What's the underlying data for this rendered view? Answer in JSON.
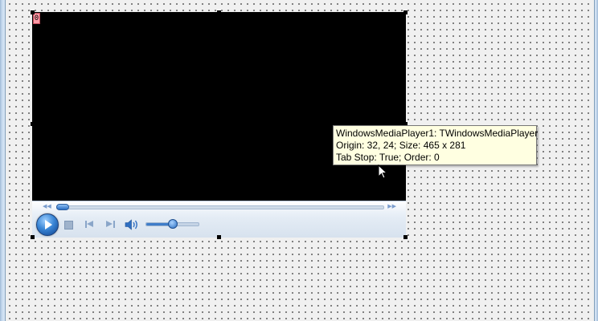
{
  "designer": {
    "grid": "dotted"
  },
  "component": {
    "index_badge": "0",
    "background_color": "#000000",
    "controls": {
      "seek_position": 0.0,
      "volume_level": 0.5,
      "icons": {
        "rewind": "rewind-icon",
        "fast_forward": "fast-forward-icon",
        "play": "play-icon",
        "stop": "stop-icon",
        "previous": "previous-track-icon",
        "next": "next-track-icon",
        "mute": "speaker-icon"
      },
      "accent_color": "#2c6fc4"
    }
  },
  "tooltip": {
    "line1": "WindowsMediaPlayer1: TWindowsMediaPlayer",
    "line2": "Origin: 32, 24; Size: 465 x 281",
    "line3": "Tab Stop: True; Order: 0",
    "background_color": "#ffffe1"
  },
  "cursor": {
    "icon": "arrow-cursor-icon"
  }
}
